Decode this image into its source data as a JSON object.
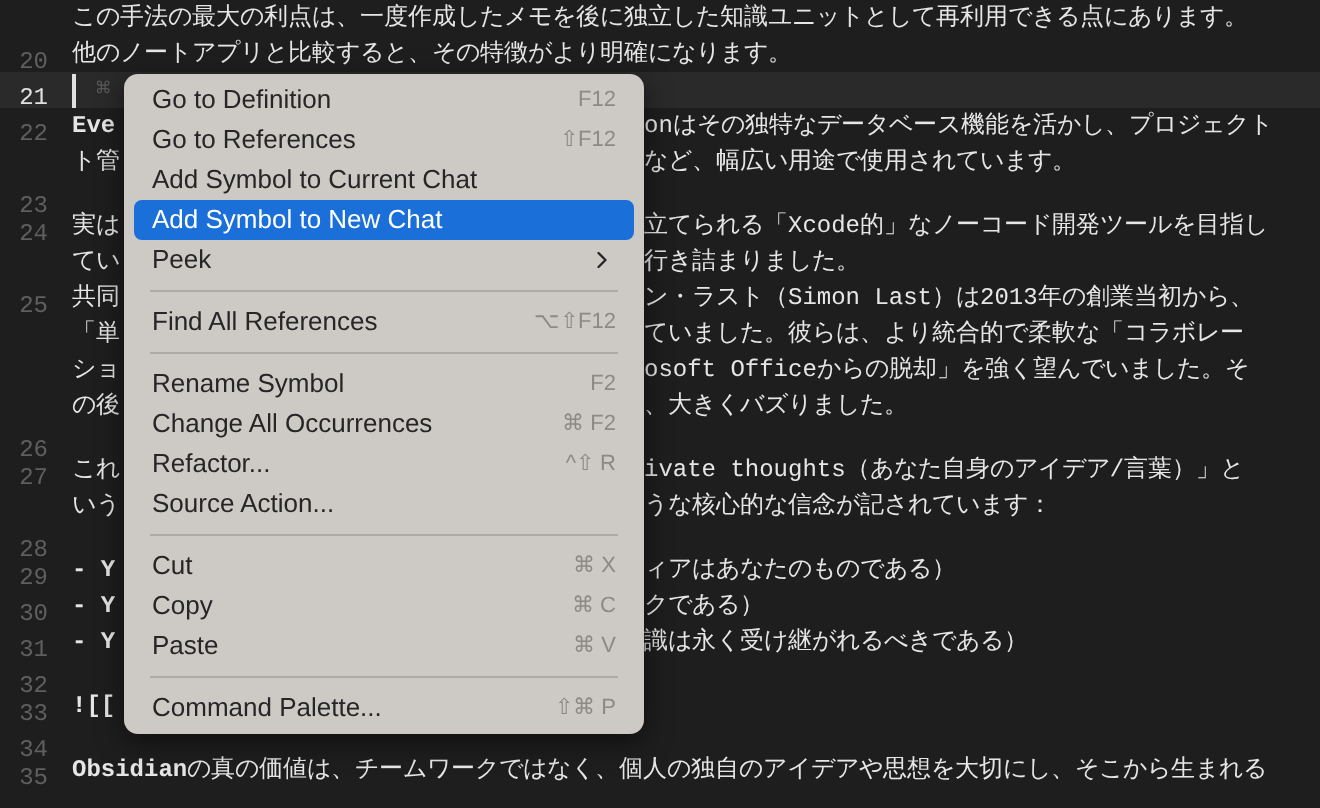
{
  "editor": {
    "lines": [
      {
        "rows": [
          {
            "left": "この手法の最大の利点は、一度作成したメモを後に独立した知識ユニットとして再利用できる点にあります。"
          }
        ]
      },
      {
        "number": "20",
        "rows": [
          {
            "left": "他のノートアプリと比較すると、その特徴がより明確になります。"
          }
        ]
      },
      {
        "number": "21",
        "current": true,
        "rows": [
          {
            "left": "⌘"
          }
        ]
      },
      {
        "number": "22",
        "rows": [
          {
            "left": "Eve",
            "strong": true,
            "right": "onはその独特なデータベース機能を活かし、プロジェクト"
          },
          {
            "left": "ト管",
            "right": "など、幅広い用途で使用されています。"
          }
        ]
      },
      {
        "number": "23"
      },
      {
        "number": "24",
        "rows": [
          {
            "left": "実は",
            "right": "立てられる「Xcode的」なノーコード開発ツールを目指し"
          },
          {
            "left": "てい",
            "right": "行き詰まりました。"
          }
        ]
      },
      {
        "number": "25",
        "rows": [
          {
            "left": "共同",
            "right": "ン・ラスト（Simon Last）は2013年の創業当初から、"
          },
          {
            "left": "「単",
            "right": "ていました。彼らは、より統合的で柔軟な「コラボレー"
          },
          {
            "left": "ショ",
            "right": "osoft Officeからの脱却」を強く望んでいました。そ"
          },
          {
            "left": "の後",
            "right": "、大きくバズりました。"
          }
        ]
      },
      {
        "number": "26"
      },
      {
        "number": "27",
        "rows": [
          {
            "left": "これ",
            "right": "ivate thoughts（あなた自身のアイデア/言葉）」と"
          },
          {
            "left": "いう",
            "right": "うな核心的な信念が記されています："
          }
        ]
      },
      {
        "number": "28"
      },
      {
        "number": "29",
        "rows": [
          {
            "left": "- Y",
            "strong": true,
            "right": "ィアはあなたのものである）"
          }
        ]
      },
      {
        "number": "30",
        "rows": [
          {
            "left": "- Y",
            "strong": true,
            "right": "クである）"
          }
        ]
      },
      {
        "number": "31",
        "rows": [
          {
            "left": "- Y",
            "strong": true,
            "right": "識は永く受け継がれるべきである）"
          }
        ]
      },
      {
        "number": "32"
      },
      {
        "number": "33",
        "rows": [
          {
            "left": "![[",
            "strong": true
          }
        ]
      },
      {
        "number": "34"
      },
      {
        "number": "35",
        "rows": [
          {
            "left": "**Obsidian**の真の価値は、チームワークではなく、個人の独自のアイデアや思想を大切にし、そこから生まれる"
          }
        ]
      }
    ]
  },
  "context_menu": {
    "items": [
      {
        "kind": "item",
        "label": "Go to Definition",
        "shortcut": "F12",
        "selected": false
      },
      {
        "kind": "item",
        "label": "Go to References",
        "shortcut": "⇧F12",
        "selected": false
      },
      {
        "kind": "item",
        "label": "Add Symbol to Current Chat",
        "selected": false
      },
      {
        "kind": "item",
        "label": "Add Symbol to New Chat",
        "selected": true
      },
      {
        "kind": "submenu",
        "label": "Peek",
        "selected": false
      },
      {
        "kind": "separator"
      },
      {
        "kind": "item",
        "label": "Find All References",
        "shortcut": "⌥⇧F12",
        "selected": false
      },
      {
        "kind": "separator"
      },
      {
        "kind": "item",
        "label": "Rename Symbol",
        "shortcut": "F2",
        "selected": false
      },
      {
        "kind": "item",
        "label": "Change All Occurrences",
        "shortcut": "⌘ F2",
        "selected": false
      },
      {
        "kind": "item",
        "label": "Refactor...",
        "shortcut": "^⇧ R",
        "selected": false
      },
      {
        "kind": "item",
        "label": "Source Action...",
        "selected": false
      },
      {
        "kind": "separator"
      },
      {
        "kind": "item",
        "label": "Cut",
        "shortcut": "⌘ X",
        "selected": false
      },
      {
        "kind": "item",
        "label": "Copy",
        "shortcut": "⌘ C",
        "selected": false
      },
      {
        "kind": "item",
        "label": "Paste",
        "shortcut": "⌘ V",
        "selected": false
      },
      {
        "kind": "separator"
      },
      {
        "kind": "item",
        "label": "Command Palette...",
        "shortcut": "⇧⌘ P",
        "selected": false
      }
    ]
  }
}
